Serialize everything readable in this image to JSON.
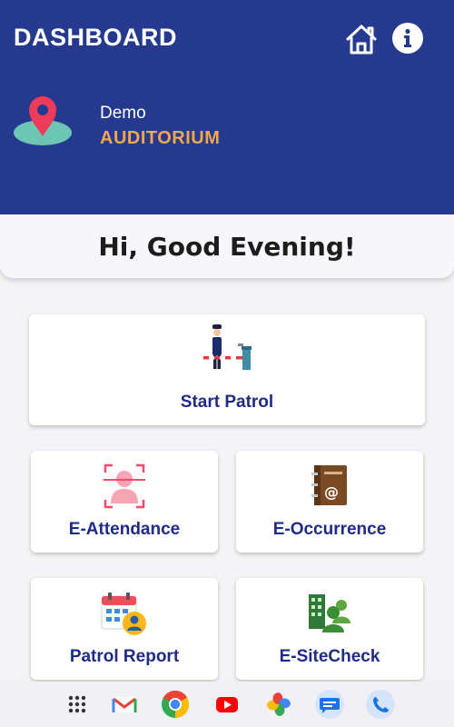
{
  "header": {
    "title": "DASHBOARD",
    "home_icon": "home-icon",
    "info_icon": "info-icon"
  },
  "location": {
    "icon": "map-pin-icon",
    "name": "Demo",
    "place": "AUDITORIUM"
  },
  "greeting": "Hi, Good Evening!",
  "tiles": [
    {
      "label": "Start Patrol",
      "icon": "guard-barrier-icon"
    },
    {
      "label": "E-Attendance",
      "icon": "face-scan-icon"
    },
    {
      "label": "E-Occurrence",
      "icon": "notebook-email-icon"
    },
    {
      "label": "Patrol Report",
      "icon": "calendar-user-icon"
    },
    {
      "label": "E-SiteCheck",
      "icon": "building-users-icon"
    }
  ],
  "nav_apps": [
    "app-drawer-icon",
    "gmail-icon",
    "chrome-icon",
    "youtube-icon",
    "photos-icon",
    "messages-icon",
    "phone-icon"
  ],
  "colors": {
    "header_bg": "#253a8f",
    "accent_orange": "#f4a64e",
    "label_blue": "#1f2b86"
  }
}
